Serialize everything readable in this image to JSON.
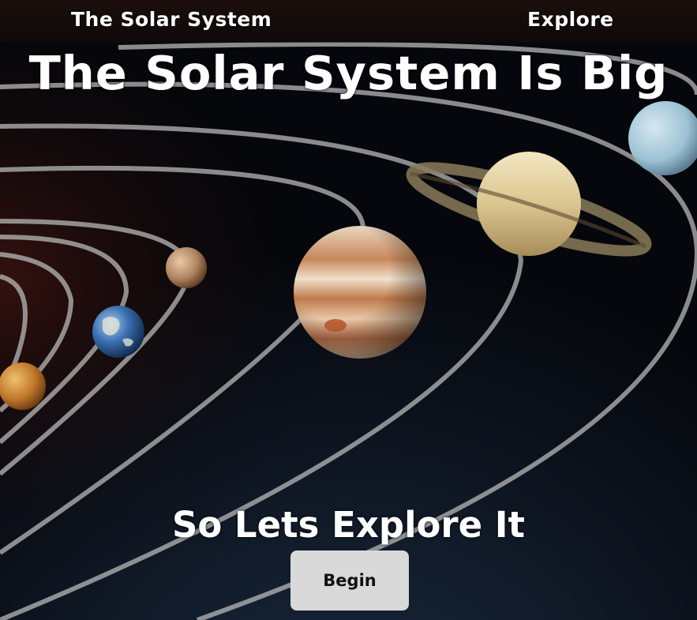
{
  "nav": {
    "title": "The Solar System",
    "explore": "Explore"
  },
  "hero": {
    "title": "The Solar System Is Big",
    "subtitle": "So Lets Explore It",
    "button": "Begin"
  },
  "colors": {
    "background": "#05070c",
    "button": "#d9d9d9",
    "text": "#ffffff"
  }
}
